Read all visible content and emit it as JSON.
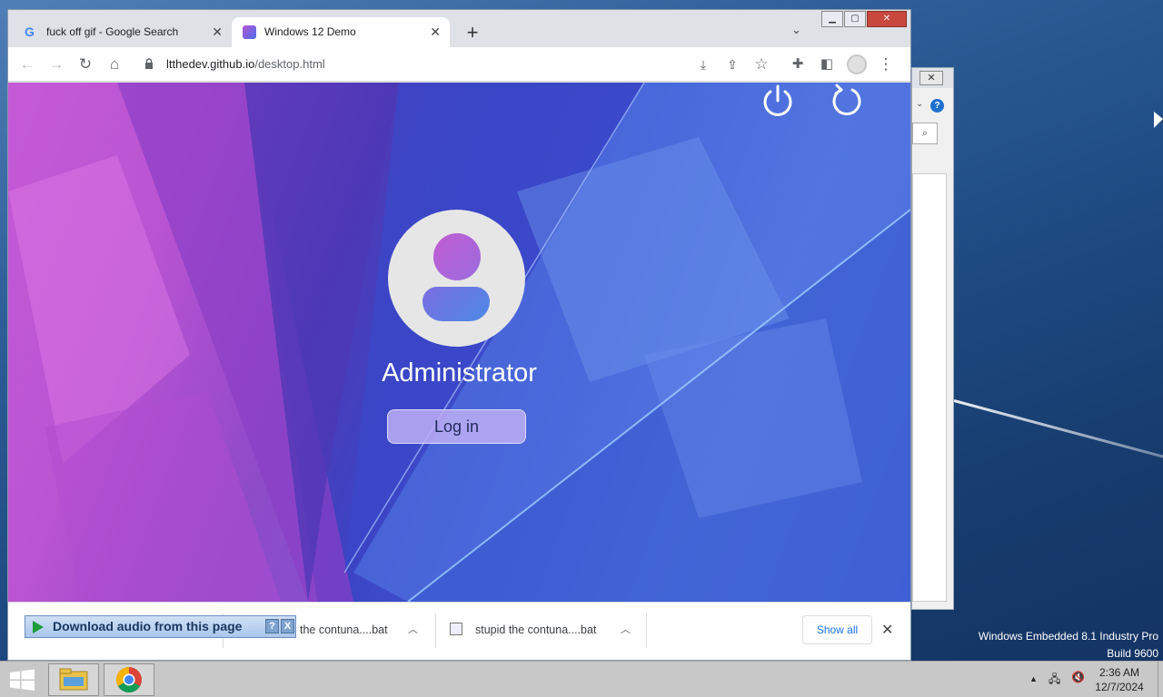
{
  "desktop": {
    "edition_line1": "Windows Embedded 8.1 Industry Pro",
    "edition_line2": "Build 9600"
  },
  "browser": {
    "tabs": [
      {
        "title": "fuck off gif - Google Search",
        "favicon": "google-icon",
        "active": false
      },
      {
        "title": "Windows 12 Demo",
        "favicon": "windows12-icon",
        "active": true
      }
    ],
    "url_host": "ltthedev.github.io",
    "url_path": "/desktop.html"
  },
  "page": {
    "username": "Administrator",
    "login_label": "Log in",
    "power_icon": "power-icon",
    "restart_icon": "restart-icon"
  },
  "downloads": {
    "items": [
      {
        "name": "the contuna....bat"
      },
      {
        "name": "stupid the contuna....bat"
      }
    ],
    "show_all": "Show all",
    "audio_bar_label": "Download audio from this page",
    "audio_help": "?",
    "audio_close": "X"
  },
  "taskbar": {
    "time": "2:36 AM",
    "date": "12/7/2024",
    "tray_caret": "▲"
  },
  "bg_window": {
    "help": "?"
  }
}
